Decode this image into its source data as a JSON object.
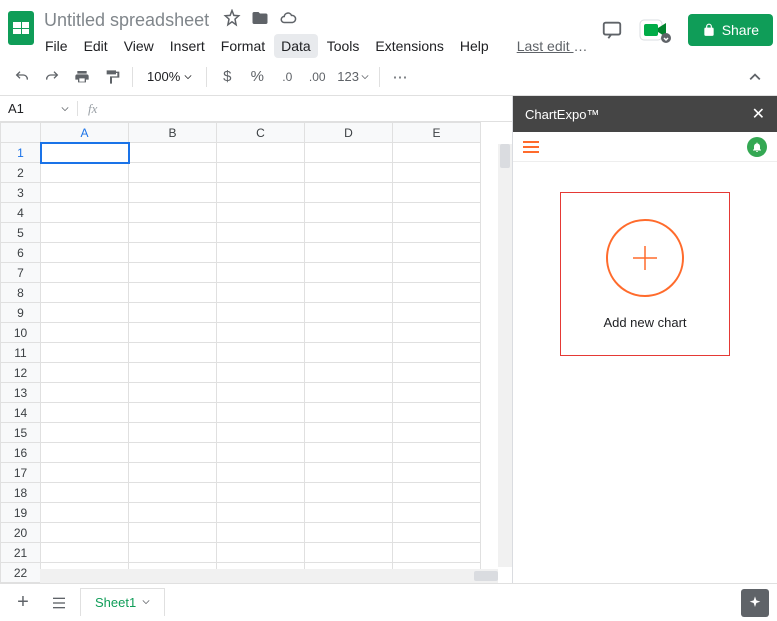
{
  "doc": {
    "title": "Untitled spreadsheet"
  },
  "menu": {
    "items": [
      "File",
      "Edit",
      "View",
      "Insert",
      "Format",
      "Data",
      "Tools",
      "Extensions",
      "Help"
    ],
    "active": "Data",
    "last_edit": "Last edit wa..."
  },
  "share": {
    "label": "Share"
  },
  "toolbar": {
    "zoom": "100%",
    "format_num": "123"
  },
  "formula": {
    "cell_ref": "A1",
    "fx": "fx"
  },
  "grid": {
    "columns": [
      "A",
      "B",
      "C",
      "D",
      "E"
    ],
    "rows_count": 22,
    "selected": "A1"
  },
  "sidebar": {
    "title": "ChartExpo™",
    "add_label": "Add new chart"
  },
  "sheets": {
    "active": "Sheet1"
  }
}
